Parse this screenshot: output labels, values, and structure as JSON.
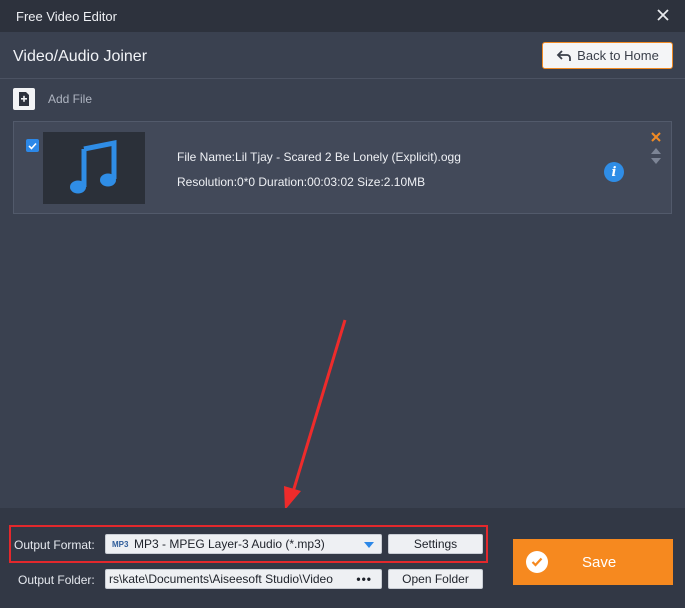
{
  "window": {
    "title": "Free Video Editor"
  },
  "header": {
    "title": "Video/Audio Joiner",
    "back_label": "Back to Home"
  },
  "toolbar": {
    "add_file_label": "Add File"
  },
  "files": [
    {
      "checked": true,
      "icon": "music-note-icon",
      "name_line": "File Name:Lil Tjay - Scared 2 Be Lonely (Explicit).ogg",
      "meta_line": "Resolution:0*0 Duration:00:03:02 Size:2.10MB"
    }
  ],
  "output": {
    "format_label": "Output Format:",
    "format_icon_text": "MP3",
    "format_value": "MP3 - MPEG Layer-3 Audio (*.mp3)",
    "settings_label": "Settings",
    "folder_label": "Output Folder:",
    "folder_value": "rs\\kate\\Documents\\Aiseesoft Studio\\Video",
    "browse_label": "•••",
    "open_folder_label": "Open Folder"
  },
  "save": {
    "label": "Save"
  },
  "colors": {
    "accent": "#f6891f",
    "background": "#3a4150",
    "highlight": "#e3282c",
    "info": "#2f8de6"
  }
}
